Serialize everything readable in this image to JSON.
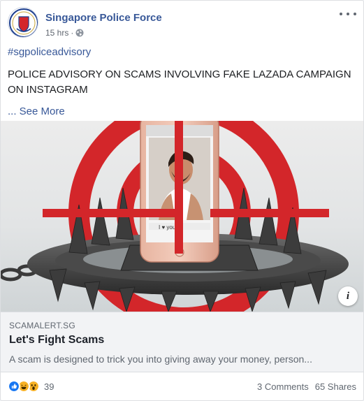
{
  "post": {
    "author": "Singapore Police Force",
    "time": "15 hrs",
    "separator": "·",
    "hashtag": "#sgpoliceadvisory",
    "headline": "POLICE ADVISORY ON SCAMS INVOLVING FAKE LAZADA CAMPAIGN ON INSTAGRAM",
    "see_more": "... See More"
  },
  "hero": {
    "phone_text": "I ♥ you!"
  },
  "link": {
    "domain": "SCAMALERT.SG",
    "title": "Let's Fight Scams",
    "description": "A scam is designed to trick you into giving away your money, person...",
    "info": "i"
  },
  "footer": {
    "reaction_count": "39",
    "comments": "3 Comments",
    "shares": "65 Shares"
  },
  "icons": [
    "police-crest-icon",
    "globe-icon",
    "more-options-icon",
    "info-icon",
    "like-reaction-icon",
    "haha-reaction-icon",
    "wow-reaction-icon"
  ],
  "colors": {
    "link_blue": "#385898",
    "target_red": "#d3262a",
    "like_blue": "#1877f2",
    "haha_yellow": "#f7b125"
  }
}
